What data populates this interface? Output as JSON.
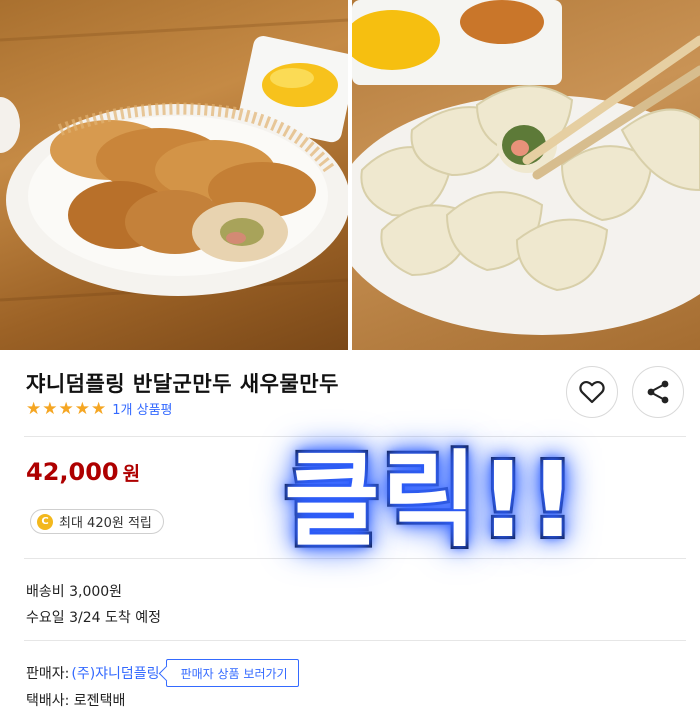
{
  "images": {
    "left": "pan-fried-crescent-dumplings-photo",
    "right": "shrimp-boiled-dumplings-photo"
  },
  "product": {
    "title": "쟈니덤플링 반달군만두 새우물만두",
    "stars": [
      "★",
      "★",
      "★",
      "★",
      "★"
    ],
    "review_count": "1개 상품평",
    "price_value": "42,000",
    "price_unit": "원",
    "reward_coin": "C",
    "reward_text": "최대 420원 적립"
  },
  "actions": {
    "favorite_icon": "heart-icon",
    "share_icon": "share-icon"
  },
  "shipping": {
    "fee": "배송비 3,000원",
    "arrival": "수요일 3/24 도착 예정"
  },
  "seller": {
    "label": "판매자:",
    "name": "(주)쟈니덤플링",
    "button": "판매자 상품 보러가기",
    "courier": "택배사: 로젠택배"
  },
  "overlay": {
    "caption": "클릭!!"
  },
  "colors": {
    "price": "#ae0000",
    "link": "#346aff",
    "star": "#f5a623",
    "overlay_glow": "#2b5cff"
  }
}
